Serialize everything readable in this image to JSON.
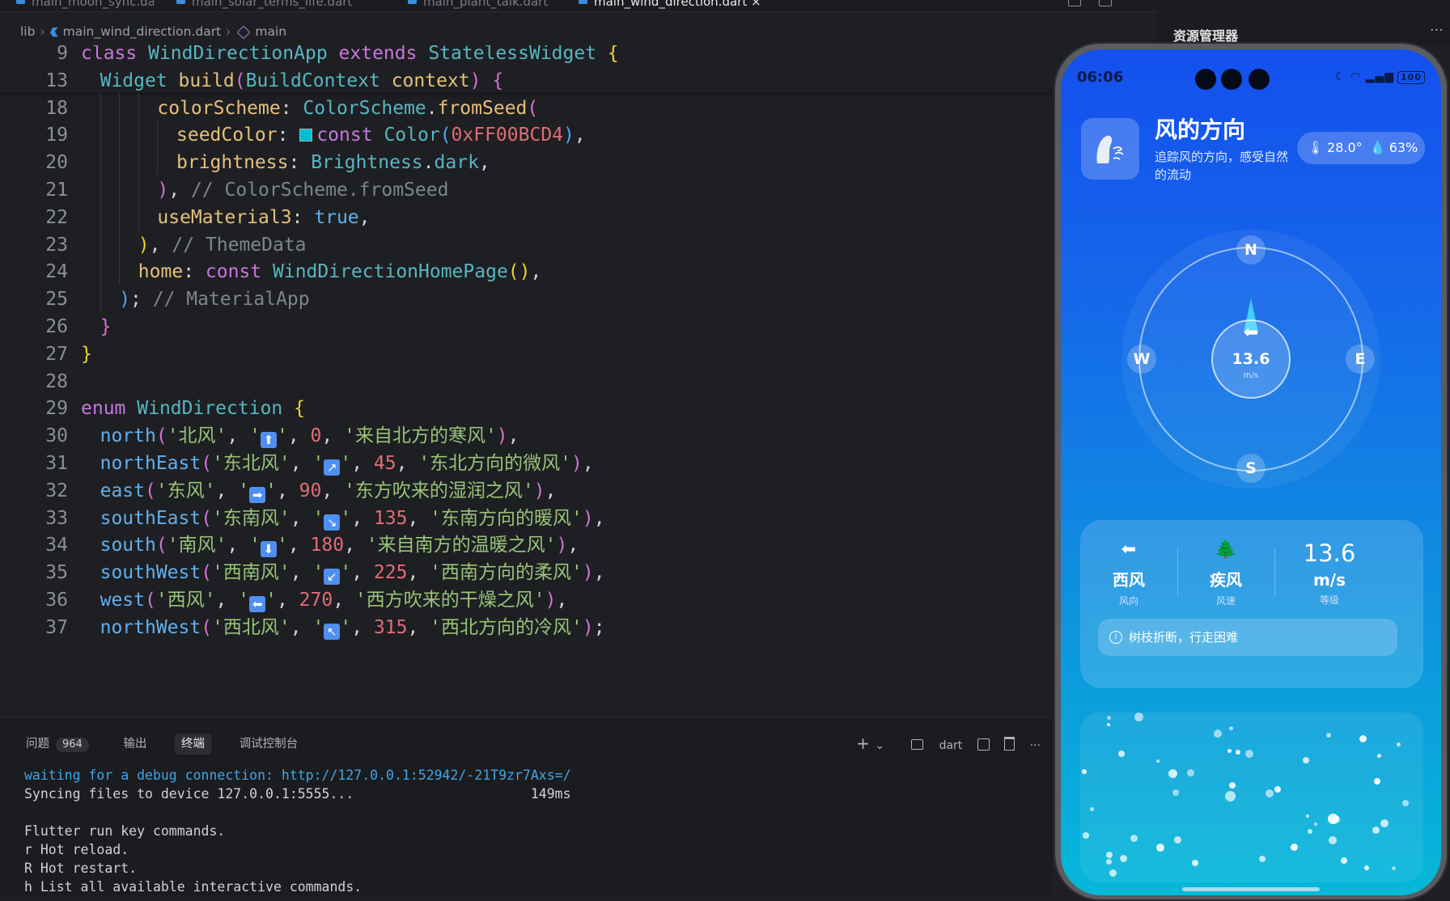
{
  "tabs": [
    {
      "label": "main_moon_sync.dart",
      "state": "dim"
    },
    {
      "label": "main_solar_terms_life.dart",
      "state": "dim"
    },
    {
      "label": "main_plant_talk.dart",
      "state": "dim"
    },
    {
      "label": "main_wind_direction.dart",
      "state": "active",
      "close": "×"
    }
  ],
  "breadcrumb": {
    "root": "lib",
    "file": "main_wind_direction.dart",
    "symbol": "main"
  },
  "explorer": {
    "title": "资源管理器",
    "more": "···"
  },
  "code_lines": [
    {
      "ln": "9",
      "indent": 0,
      "html": "<span class=\"k\">class</span> <span class=\"t\">WindDirectionApp</span> <span class=\"k\">extends</span> <span class=\"t\">StatelessWidget</span> <span class=\"y\">{</span>"
    },
    {
      "ln": "13",
      "indent": 1,
      "html": "<span class=\"t\">Widget</span> <span class=\"f\">build</span><span class=\"m\">(</span><span class=\"t\">BuildContext</span> <span class=\"f\">context</span><span class=\"m\">)</span> <span class=\"m\">{</span>"
    },
    {
      "ln": "18",
      "indent": 4,
      "html": "<span class=\"f\">colorScheme</span>: <span class=\"t\">ColorScheme</span>.<span class=\"f\">fromSeed</span><span class=\"m\">(</span>"
    },
    {
      "ln": "19",
      "indent": 5,
      "html": "<span class=\"f\">seedColor</span>: <span class=\"sw\"></span><span class=\"k\">const</span> <span class=\"t\">Color</span><span class=\"b\">(</span><span class=\"n\">0xFF00BCD4</span><span class=\"b\">)</span>,"
    },
    {
      "ln": "20",
      "indent": 5,
      "html": "<span class=\"f\">brightness</span>: <span class=\"t\">Brightness</span>.<span class=\"t\">dark</span>,"
    },
    {
      "ln": "21",
      "indent": 4,
      "html": "<span class=\"m\">)</span>, <span class=\"c\">// ColorScheme.fromSeed</span>"
    },
    {
      "ln": "22",
      "indent": 4,
      "html": "<span class=\"f\">useMaterial3</span>: <span class=\"p\">true</span>,"
    },
    {
      "ln": "23",
      "indent": 3,
      "html": "<span class=\"y\">)</span>, <span class=\"c\">// ThemeData</span>"
    },
    {
      "ln": "24",
      "indent": 3,
      "html": "<span class=\"f\">home</span>: <span class=\"k\">const</span> <span class=\"t\">WindDirectionHomePage</span><span class=\"y\">()</span>,"
    },
    {
      "ln": "25",
      "indent": 2,
      "html": "<span class=\"b\">)</span>; <span class=\"c\">// MaterialApp</span>"
    },
    {
      "ln": "26",
      "indent": 1,
      "html": "<span class=\"m\">}</span>"
    },
    {
      "ln": "27",
      "indent": 0,
      "html": "<span class=\"y\">}</span>"
    },
    {
      "ln": "28",
      "indent": 0,
      "html": ""
    },
    {
      "ln": "29",
      "indent": 0,
      "html": "<span class=\"k\">enum</span> <span class=\"t\">WindDirection</span> <span class=\"y\">{</span>"
    },
    {
      "ln": "30",
      "indent": 1,
      "html": "<span class=\"p\">north</span><span class=\"m\">(</span><span class=\"s\">'北风'</span>, <span class=\"s\">'<span class=\"emo\">⬆</span>'</span>, <span class=\"n\">0</span>, <span class=\"s\">'来自北方的寒风'</span><span class=\"m\">)</span>,"
    },
    {
      "ln": "31",
      "indent": 1,
      "html": "<span class=\"p\">northEast</span><span class=\"m\">(</span><span class=\"s\">'东北风'</span>, <span class=\"s\">'<span class=\"emo\">↗</span>'</span>, <span class=\"n\">45</span>, <span class=\"s\">'东北方向的微风'</span><span class=\"m\">)</span>,"
    },
    {
      "ln": "32",
      "indent": 1,
      "html": "<span class=\"p\">east</span><span class=\"m\">(</span><span class=\"s\">'东风'</span>, <span class=\"s\">'<span class=\"emo\">➡</span>'</span>, <span class=\"n\">90</span>, <span class=\"s\">'东方吹来的湿润之风'</span><span class=\"m\">)</span>,"
    },
    {
      "ln": "33",
      "indent": 1,
      "html": "<span class=\"p\">southEast</span><span class=\"m\">(</span><span class=\"s\">'东南风'</span>, <span class=\"s\">'<span class=\"emo\">↘</span>'</span>, <span class=\"n\">135</span>, <span class=\"s\">'东南方向的暖风'</span><span class=\"m\">)</span>,"
    },
    {
      "ln": "34",
      "indent": 1,
      "html": "<span class=\"p\">south</span><span class=\"m\">(</span><span class=\"s\">'南风'</span>, <span class=\"s\">'<span class=\"emo\">⬇</span>'</span>, <span class=\"n\">180</span>, <span class=\"s\">'来自南方的温暖之风'</span><span class=\"m\">)</span>,"
    },
    {
      "ln": "35",
      "indent": 1,
      "html": "<span class=\"p\">southWest</span><span class=\"m\">(</span><span class=\"s\">'西南风'</span>, <span class=\"s\">'<span class=\"emo\">↙</span>'</span>, <span class=\"n\">225</span>, <span class=\"s\">'西南方向的柔风'</span><span class=\"m\">)</span>,"
    },
    {
      "ln": "36",
      "indent": 1,
      "html": "<span class=\"p\">west</span><span class=\"m\">(</span><span class=\"s\">'西风'</span>, <span class=\"s\">'<span class=\"emo\">⬅</span>'</span>, <span class=\"n\">270</span>, <span class=\"s\">'西方吹来的干燥之风'</span><span class=\"m\">)</span>,"
    },
    {
      "ln": "37",
      "indent": 1,
      "html": "<span class=\"p\">northWest</span><span class=\"m\">(</span><span class=\"s\">'西北风'</span>, <span class=\"s\">'<span class=\"emo\">↖</span>'</span>, <span class=\"n\">315</span>, <span class=\"s\">'西北方向的冷风'</span><span class=\"m\">)</span>;"
    }
  ],
  "panel": {
    "tabs": {
      "problems": "问题",
      "problems_count": "964",
      "output": "输出",
      "terminal": "终端",
      "debug": "调试控制台"
    },
    "toolbar": {
      "add": "+",
      "dropdown": "⌄",
      "shell": "dart",
      "more": "···"
    },
    "terminal": {
      "link_line": "waiting for a debug connection: http://127.0.0.1:52942/-21T9zr7Axs=/",
      "sync_line": "Syncing files to device 127.0.0.1:5555...",
      "sync_time": "149ms",
      "line3": "Flutter run key commands.",
      "line4": "r Hot reload.",
      "line5": "R Hot restart.",
      "line6": "h List all available interactive commands."
    }
  },
  "phone": {
    "time": "06:06",
    "battery": "100",
    "app": {
      "title": "风的方向",
      "subtitle": "追踪风的方向，感受自然的流动",
      "temperature": "28.0°",
      "humidity": "63%"
    },
    "compass": {
      "n": "N",
      "s": "S",
      "e": "E",
      "w": "W",
      "speed": "13.6",
      "unit": "m/s",
      "arrow": "⬅"
    },
    "stats": [
      {
        "icon": "⬅",
        "value": "西风",
        "label": "风向"
      },
      {
        "icon": "🌲",
        "value": "疾风",
        "label": "风速"
      },
      {
        "icon": "",
        "value_top": "13.6",
        "value": "m/s",
        "label": "等级"
      }
    ],
    "notice": "树枝折断，行走困难",
    "colors": {
      "accent": "#00BCD4",
      "bg_top": "#1450EE",
      "bg_bottom": "#05B8D8"
    }
  }
}
